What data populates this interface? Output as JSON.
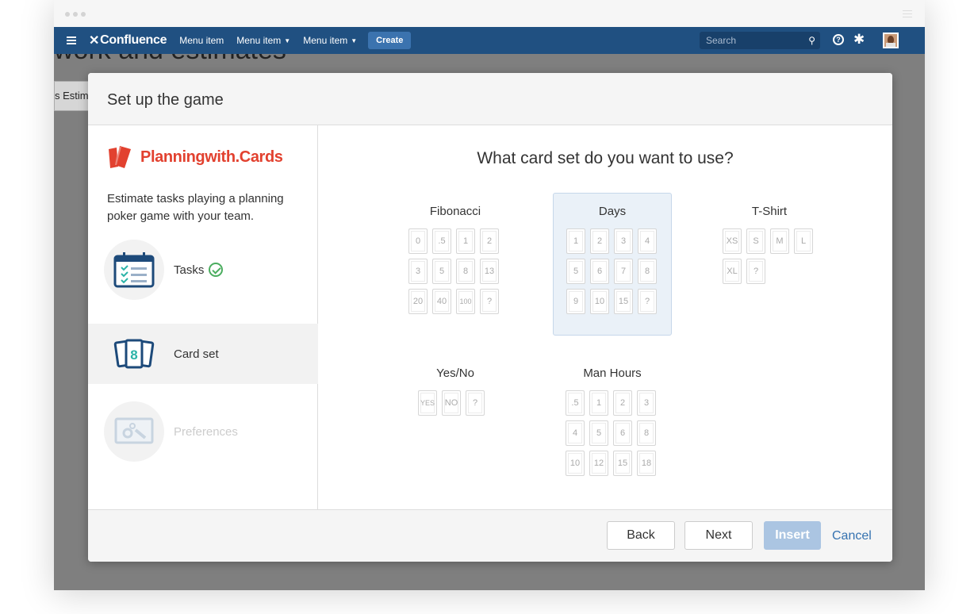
{
  "nav": {
    "logo": "Confluence",
    "menu_items": [
      "Menu item",
      "Menu item",
      "Menu item"
    ],
    "create_label": "Create",
    "search_placeholder": "Search",
    "help_icon": "question-circle-icon",
    "settings_icon": "gear-icon"
  },
  "background_page": {
    "title": "work and estimates",
    "tab_label": "s Estim"
  },
  "dialog": {
    "title": "Set up the game",
    "brand": "Planningwith.Cards",
    "tagline": "Estimate tasks playing a planning poker game with your team.",
    "steps": [
      {
        "label": "Tasks",
        "icon": "checklist-icon",
        "state": "completed"
      },
      {
        "label": "Card set",
        "icon": "cards-icon",
        "state": "active"
      },
      {
        "label": "Preferences",
        "icon": "wrench-gears-icon",
        "state": "disabled"
      }
    ],
    "question": "What card set do you want to use?",
    "card_sets": [
      {
        "name": "Fibonacci",
        "cards": [
          "0",
          ".5",
          "1",
          "2",
          "3",
          "5",
          "8",
          "13",
          "20",
          "40",
          "100",
          "?"
        ],
        "selected": false
      },
      {
        "name": "Days",
        "cards": [
          "1",
          "2",
          "3",
          "4",
          "5",
          "6",
          "7",
          "8",
          "9",
          "10",
          "15",
          "?"
        ],
        "selected": true
      },
      {
        "name": "T-Shirt",
        "cards": [
          "XS",
          "S",
          "M",
          "L",
          "XL",
          "?"
        ],
        "selected": false
      },
      {
        "name": "Yes/No",
        "cards": [
          "YES",
          "NO",
          "?"
        ],
        "selected": false
      },
      {
        "name": "Man Hours",
        "cards": [
          ".5",
          "1",
          "2",
          "3",
          "4",
          "5",
          "6",
          "8",
          "10",
          "12",
          "15",
          "18"
        ],
        "selected": false
      }
    ],
    "footer": {
      "back": "Back",
      "next": "Next",
      "insert": "Insert",
      "cancel": "Cancel"
    }
  },
  "colors": {
    "nav_bg": "#205081",
    "brand_red": "#e2412f",
    "selected_bg": "#eaf1f8",
    "link_blue": "#3572b0",
    "check_green": "#4bad5f"
  }
}
